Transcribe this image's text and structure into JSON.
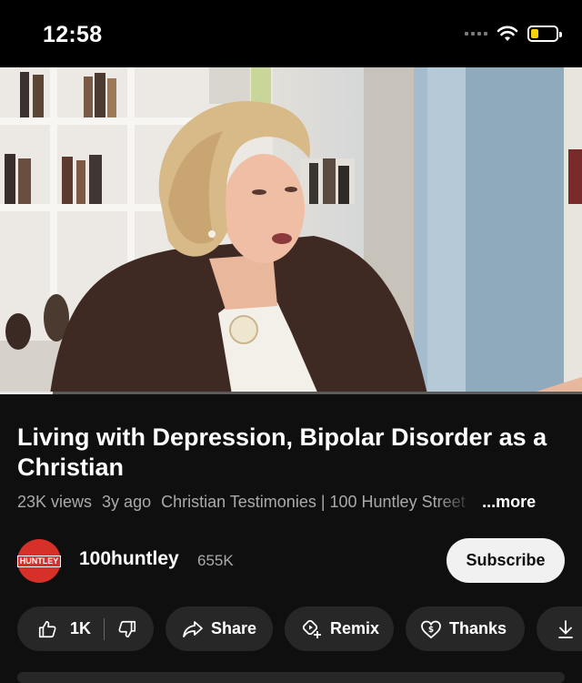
{
  "status_bar": {
    "time": "12:58"
  },
  "video": {
    "progress": 0.09
  },
  "title": "Living with Depression, Bipolar Disorder as a Christian",
  "meta": {
    "views": "23K views",
    "age": "3y ago",
    "description": "Christian Testimonies | 100 Huntley Street",
    "more": "...more"
  },
  "channel": {
    "logo_text": "HUNTLEY",
    "name": "100huntley",
    "subscribers": "655K",
    "subscribe_label": "Subscribe"
  },
  "actions": {
    "like_count": "1K",
    "share_label": "Share",
    "remix_label": "Remix",
    "thanks_label": "Thanks"
  }
}
